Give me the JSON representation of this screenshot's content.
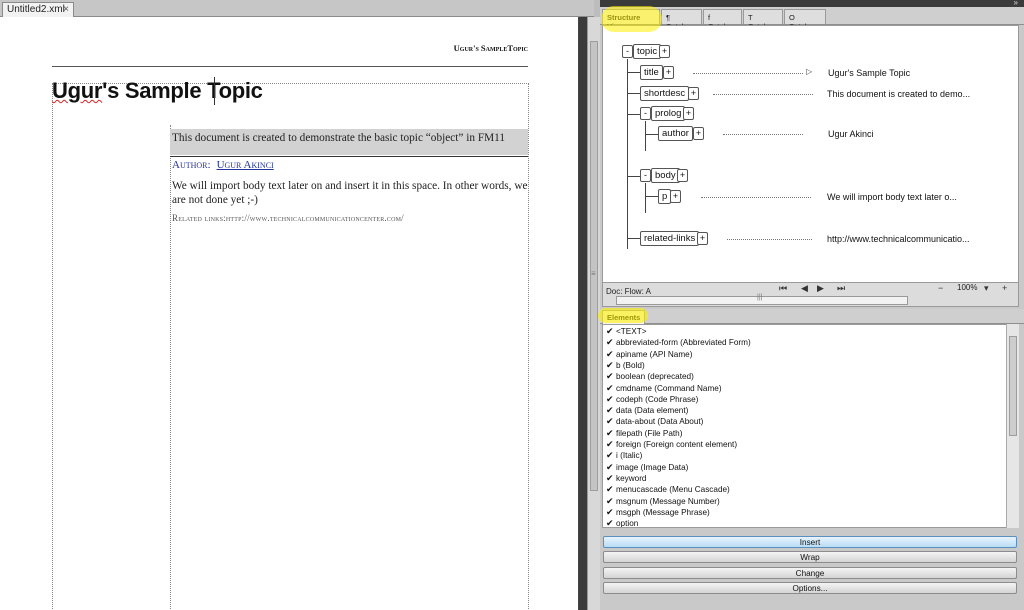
{
  "document": {
    "tab_label": "Untitled2.xml",
    "tab_close": "×",
    "running_head": "Ugur's SampleTopic",
    "title": "Ugur's Sample Topic",
    "title_a": "Ugur",
    "title_b": "'s Sample Topic",
    "shortdesc": "This document is created to demonstrate the basic topic “object” in FM11",
    "author_label": "Author:",
    "author_name": "Ugur Akinci",
    "body": "We will import body text later on and insert it in this space. In other words, we are not done yet ;-)",
    "related": "Related links:http://www.technicalcommunicationcenter.com/"
  },
  "structure_tabs": [
    {
      "label": "Structure View",
      "active": true
    },
    {
      "label": "¶ Catalog",
      "active": false
    },
    {
      "label": "f Catalog",
      "active": false
    },
    {
      "label": "T Catalog",
      "active": false
    },
    {
      "label": "O Catalog",
      "active": false
    }
  ],
  "structure_tree": {
    "topic": "topic",
    "title": "title",
    "shortdesc": "shortdesc",
    "prolog": "prolog",
    "author": "author",
    "body": "body",
    "p": "p",
    "related": "related-links",
    "minus": "-",
    "plus": "+",
    "tri": "▷",
    "values": {
      "title": "Ugur's Sample Topic",
      "shortdesc": "This document is created to demo...",
      "author": "Ugur Akinci",
      "p": "We will import body text later o...",
      "related": "http://www.technicalcommunicatio..."
    }
  },
  "structure_status": {
    "doc_flow": "Doc:  Flow: A",
    "zoom": "100%",
    "nav_first": "⏮",
    "nav_prev": "◀",
    "nav_next": "▶",
    "nav_last": "⏭",
    "zoom_out": "−",
    "zoom_in": "+",
    "zoom_arrow": "▾"
  },
  "elements_panel": {
    "tab": "Elements",
    "check": "✔",
    "items": [
      "<TEXT>",
      "abbreviated-form  (Abbreviated Form)",
      "apiname  (API Name)",
      "b  (Bold)",
      "boolean  (deprecated)",
      "cmdname  (Command Name)",
      "codeph  (Code Phrase)",
      "data  (Data element)",
      "data-about  (Data About)",
      "filepath  (File Path)",
      "foreign  (Foreign content element)",
      "i  (Italic)",
      "image  (Image Data)",
      "keyword",
      "menucascade  (Menu Cascade)",
      "msgnum  (Message Number)",
      "msgph  (Message Phrase)",
      "option"
    ]
  },
  "actions": {
    "insert": "Insert",
    "wrap": "Wrap",
    "change": "Change",
    "options": "Options..."
  },
  "colors": {
    "highlight": "#fff000",
    "link": "#223399"
  }
}
